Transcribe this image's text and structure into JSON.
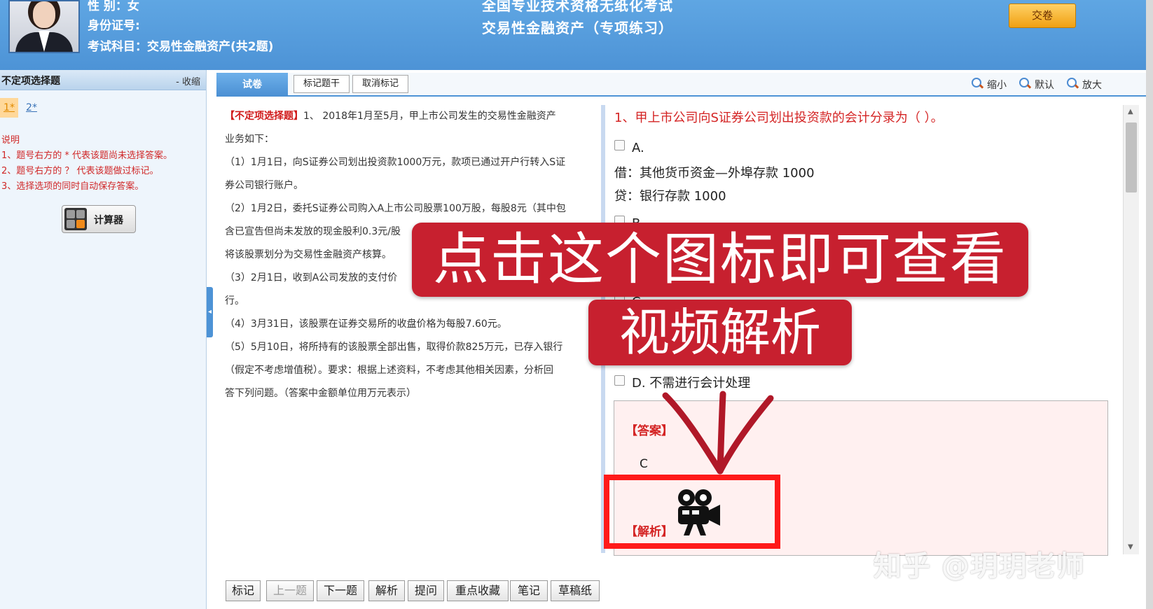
{
  "header": {
    "gender_label": "性 别：女",
    "id_label": "身份证号:",
    "subject_label": "考试科目：交易性金融资产(共2题)",
    "exam_title": "全国专业技术资格无纸化考试",
    "exam_subtitle": "交易性金融资产（专项练习）",
    "submit_label": "交卷"
  },
  "sidebar": {
    "title": "不定项选择题",
    "collapse_label": "- 收缩",
    "question_numbers": [
      "1*",
      "2*"
    ],
    "notes_title": "说明",
    "notes": [
      "1、题号右方的 * 代表该题尚未选择答案。",
      "2、题号右方的 ？ 代表该题做过标记。",
      "3、选择选项的同时自动保存答案。"
    ],
    "calculator_label": "计算器"
  },
  "toolbar": {
    "tab_label": "试卷",
    "mark_stem_label": "标记题干",
    "cancel_mark_label": "取消标记",
    "zoom_out_label": "缩小",
    "zoom_default_label": "默认",
    "zoom_in_label": "放大"
  },
  "stem": {
    "tag": "【不定项选择题】",
    "lines": [
      "1、 2018年1月至5月，甲上市公司发生的交易性金融资产",
      "业务如下：",
      "（1）1月1日，向S证券公司划出投资款1000万元，款项已通过开户行转入S证",
      "券公司银行账户。",
      "（2）1月2日，委托S证券公司购入A上市公司股票100万股，每股8元（其中包",
      "含已宣告但尚未发放的现金股利0.3元/股",
      "将该股票划分为交易性金融资产核算。",
      "（3）2月1日，收到A公司发放的支付价",
      "行。",
      "（4）3月31日，该股票在证券交易所的收盘价格为每股7.60元。",
      "（5）5月10日，将所持有的该股票全部出售，取得价款825万元，已存入银行",
      "（假定不考虑增值税）。要求：根据上述资料，不考虑其他相关因素，分析回",
      "答下列问题。（答案中金额单位用万元表示）"
    ]
  },
  "question": {
    "title": "1、甲上市公司向S证券公司划出投资款的会计分录为（ ）。",
    "option_a_label": "A.",
    "option_a_line1": "借：其他货币资金—外埠存款 1000",
    "option_a_line2": "贷：银行存款 1000",
    "option_b_label": "B.",
    "option_c_label": "C.",
    "option_d_label": "D. 不需进行会计处理",
    "answer_label": "【答案】",
    "answer_value": "C",
    "analysis_label": "【解析】"
  },
  "bottom_buttons": [
    "标记",
    "上一题",
    "下一题",
    "解析",
    "提问",
    "重点收藏",
    "笔记",
    "草稿纸"
  ],
  "overlay": {
    "line1": "点击这个图标即可查看",
    "line2": "视频解析"
  },
  "watermark": "知乎 @玥玥老师",
  "icons": {
    "calculator": "calculator-icon",
    "video": "video-camera-icon",
    "zoom": "magnifier-icon"
  },
  "colors": {
    "header_blue": "#4d93d6",
    "accent_red": "#d42424",
    "banner_red": "#c7202f",
    "frame_red": "#ff1a1a",
    "submit_orange": "#f0a012"
  }
}
